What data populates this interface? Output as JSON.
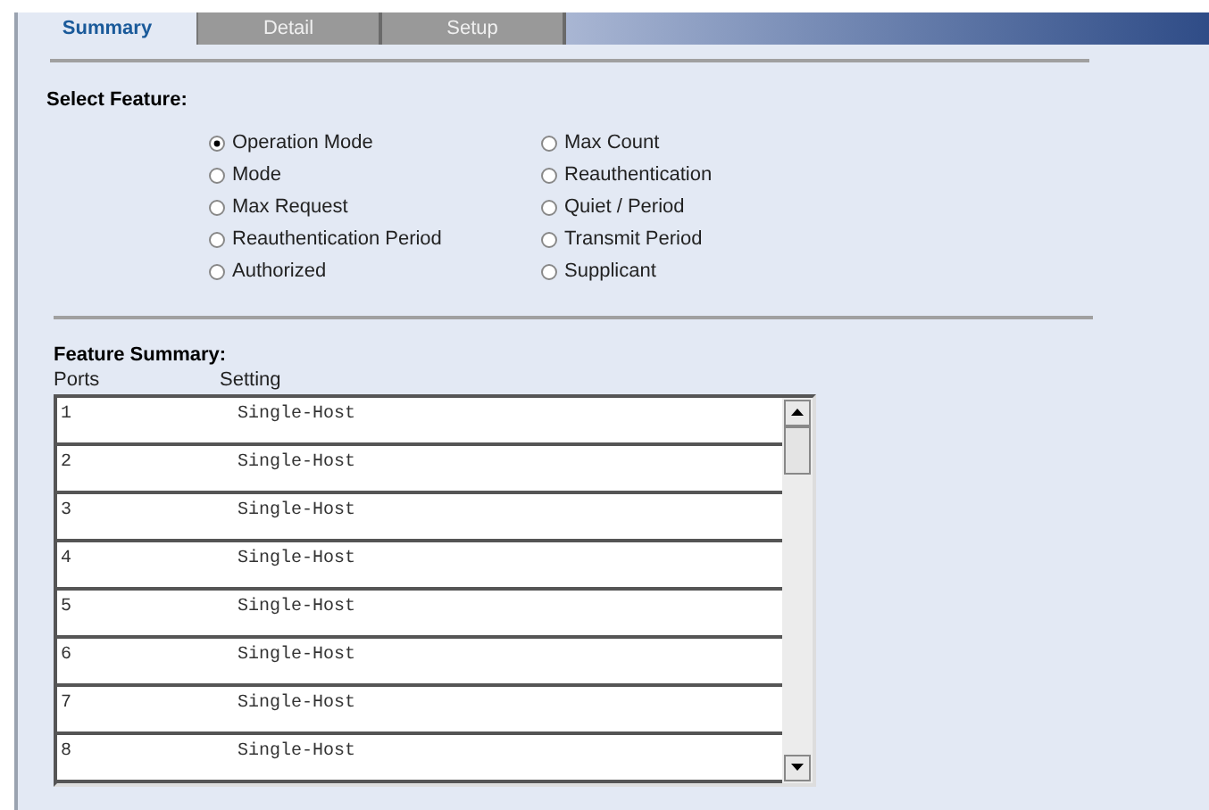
{
  "tabs": [
    {
      "label": "Summary",
      "selected": true
    },
    {
      "label": "Detail",
      "selected": false
    },
    {
      "label": "Setup",
      "selected": false
    }
  ],
  "select_feature": {
    "title": "Select Feature:",
    "options": [
      {
        "label": "Operation Mode",
        "selected": true
      },
      {
        "label": "Mode",
        "selected": false
      },
      {
        "label": "Max Request",
        "selected": false
      },
      {
        "label": "Reauthentication Period",
        "selected": false
      },
      {
        "label": "Authorized",
        "selected": false
      },
      {
        "label": "Max Count",
        "selected": false
      },
      {
        "label": "Reauthentication",
        "selected": false
      },
      {
        "label": "Quiet / Period",
        "selected": false
      },
      {
        "label": "Transmit Period",
        "selected": false
      },
      {
        "label": "Supplicant",
        "selected": false
      }
    ]
  },
  "feature_summary": {
    "title": "Feature Summary:",
    "columns": [
      "Ports",
      "Setting"
    ],
    "rows": [
      [
        "1",
        "Single-Host"
      ],
      [
        "2",
        "Single-Host"
      ],
      [
        "3",
        "Single-Host"
      ],
      [
        "4",
        "Single-Host"
      ],
      [
        "5",
        "Single-Host"
      ],
      [
        "6",
        "Single-Host"
      ],
      [
        "7",
        "Single-Host"
      ],
      [
        "8",
        "Single-Host"
      ]
    ]
  }
}
